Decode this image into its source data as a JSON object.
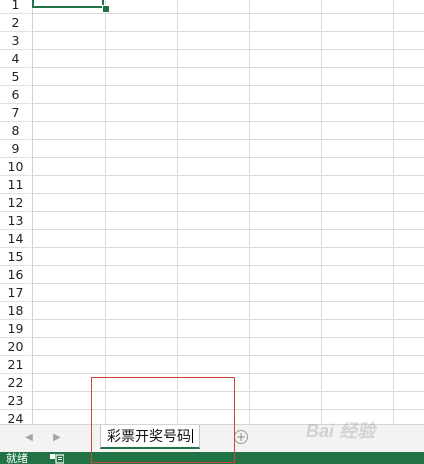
{
  "row_numbers": [
    "1",
    "2",
    "3",
    "4",
    "5",
    "6",
    "7",
    "8",
    "9",
    "10",
    "11",
    "12",
    "13",
    "14",
    "15",
    "16",
    "17",
    "18",
    "19",
    "20",
    "21",
    "22",
    "23",
    "24"
  ],
  "sheet_tabs": [
    {
      "label": "彩票开奖号码",
      "active": true
    }
  ],
  "tab_bar": {
    "prev_icon": "chevron-left-icon",
    "next_icon": "chevron-right-icon",
    "add_icon": "plus-circle-icon"
  },
  "status_bar": {
    "mode_text": "就绪",
    "macro_icon": "macro-record-icon"
  },
  "colors": {
    "accent": "#217346",
    "annotation": "#d0453c",
    "gridline": "#dadada"
  },
  "watermark": {
    "text": "Bai  经验"
  }
}
